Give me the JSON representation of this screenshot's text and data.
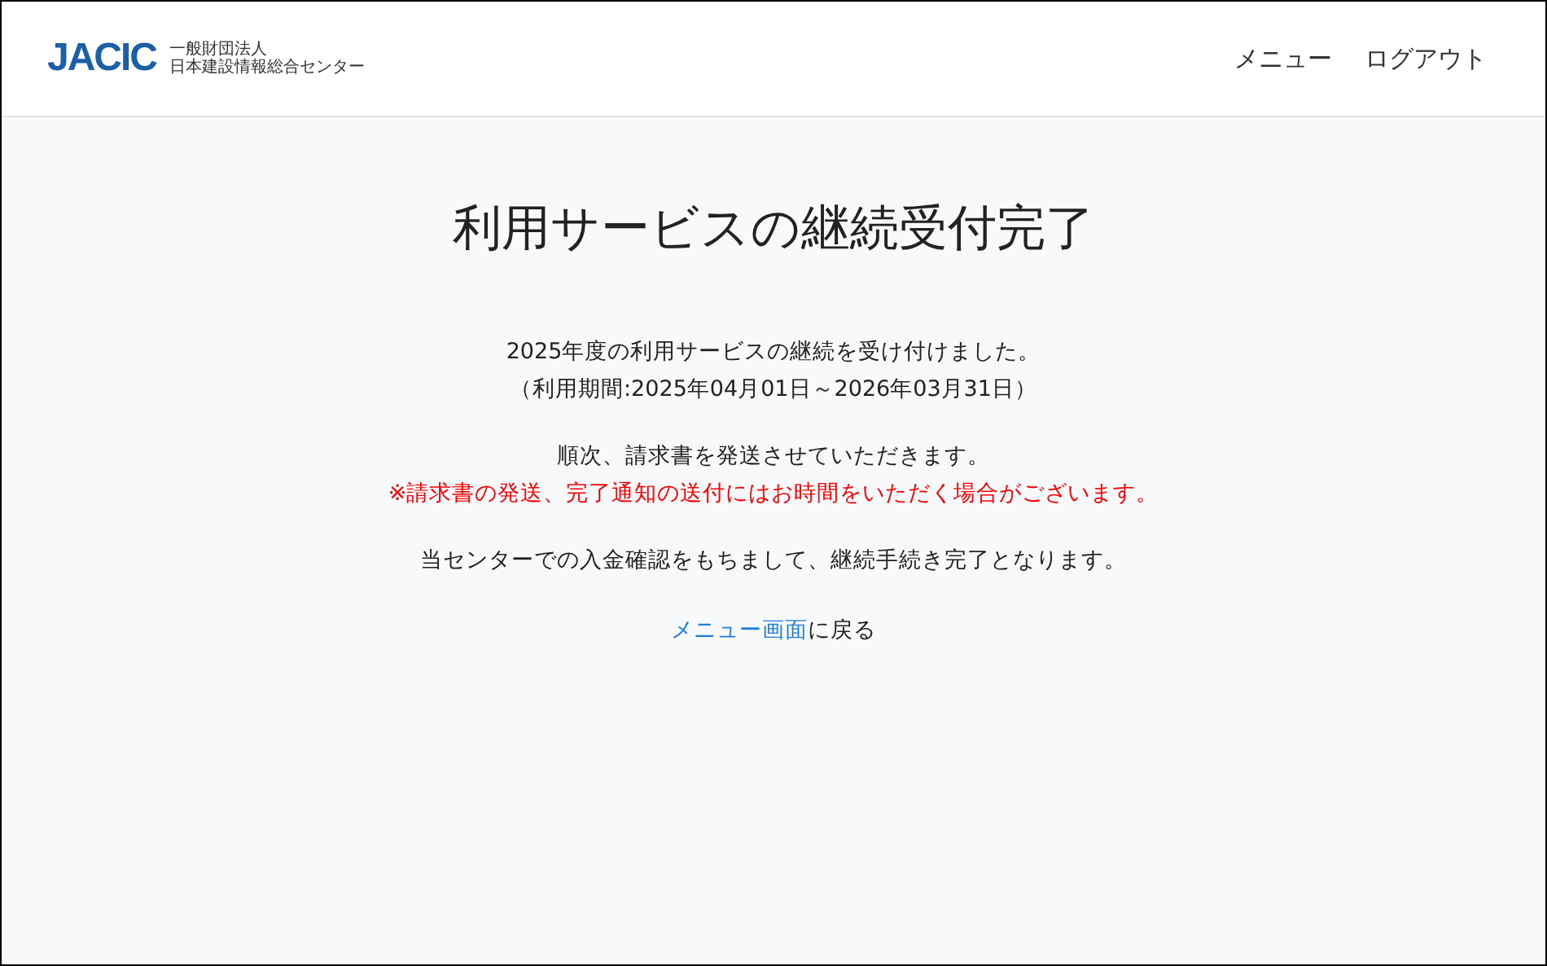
{
  "header": {
    "logo": "JACIC",
    "org_line1": "一般財団法人",
    "org_line2": "日本建設情報総合センター",
    "nav": [
      "メニュー",
      "ログアウト"
    ]
  },
  "title": "利用サービスの継続受付完了",
  "paragraphs": [
    {
      "lines": [
        {
          "text": "2025年度の利用サービスの継続を受け付けました。",
          "kind": "normal"
        },
        {
          "text": "（利用期間:2025年04月01日～2026年03月31日）",
          "kind": "normal"
        }
      ]
    },
    {
      "lines": [
        {
          "text": "順次、請求書を発送させていただきます。",
          "kind": "normal"
        },
        {
          "text": "※請求書の発送、完了通知の送付にはお時間をいただく場合がございます。",
          "kind": "warning"
        }
      ]
    },
    {
      "lines": [
        {
          "text": "当センターでの入金確認をもちまして、継続手続き完了となります。",
          "kind": "normal"
        }
      ]
    }
  ],
  "back": {
    "link": "メニュー画面",
    "rest": "に戻る"
  }
}
